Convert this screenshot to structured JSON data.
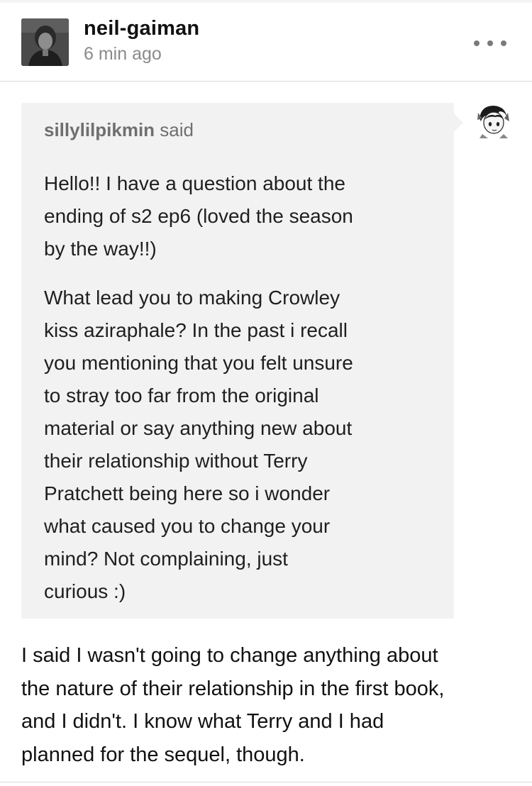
{
  "post": {
    "author": "neil-gaiman",
    "timestamp": "6 min ago",
    "avatar_icon": "author-avatar-photo",
    "more_icon": "more-options-icon"
  },
  "ask": {
    "asker": "sillylilpikmin",
    "said": "said",
    "asker_avatar_icon": "asker-avatar-image",
    "paragraphs": [
      [
        "Hello!! I have a question about the",
        "ending of s2 ep6 (loved the season",
        "by the way!!)"
      ],
      [
        "What lead you to making Crowley",
        "kiss aziraphale? In the past i recall",
        "you mentioning that you felt unsure",
        "to stray too far from the original",
        "material or say anything new about",
        "their relationship without Terry",
        "Pratchett being here so i wonder",
        "what caused you to change your",
        "mind? Not complaining, just",
        "curious :)"
      ]
    ]
  },
  "answer": {
    "lines": [
      "I said I wasn't going to change anything about",
      "the nature of  their relationship in the first book,",
      "and I didn't. I know what Terry and I had",
      "planned for the sequel, though."
    ]
  },
  "colors": {
    "bubble_bg": "#f2f2f2",
    "meta_gray": "#8a8a8a",
    "text": "#111111"
  }
}
